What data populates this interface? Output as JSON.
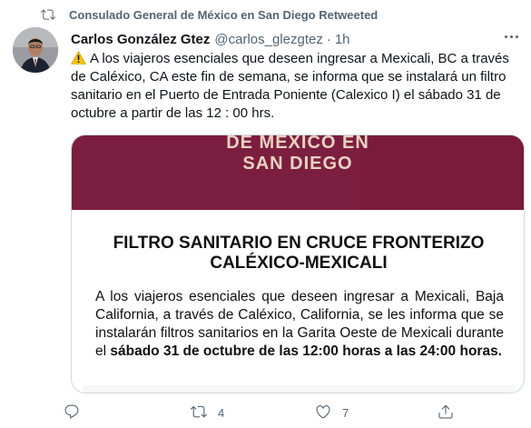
{
  "retweet": {
    "icon": "retweet-icon",
    "text": "Consulado General de México en San Diego Retweeted"
  },
  "tweet": {
    "avatar": "avatar",
    "display_name": "Carlos González Gtez",
    "handle": "@carlos_glezgtez",
    "separator": "·",
    "time": "1h",
    "more_icon": "more-icon",
    "warning_icon": "warning-icon",
    "text": "A los viajeros esenciales que deseen ingresar a Mexicali, BC a través de Caléxico, CA este fin de semana, se informa que se instalará un filtro sanitario en el Puerto de Entrada Poniente (Calexico I) el sábado 31 de octubre a partir de las 12 : 00 hrs."
  },
  "media": {
    "banner_line_1": "DE MÉXICO EN",
    "banner_line_2": "SAN DIEGO",
    "banner_color": "#7c1e3f",
    "title_line_1": "FILTRO SANITARIO EN CRUCE FRONTERIZO",
    "title_line_2": "CALÉXICO-MEXICALI",
    "body_plain": "A los viajeros esenciales que deseen ingresar a Mexicali, Baja California, a través de Caléxico, California, se les informa que se instalarán filtros sanitarios en la Garita Oeste de Mexicali durante el ",
    "body_bold": "sábado 31 de octubre de las 12:00 horas a las 24:00 horas."
  },
  "actions": {
    "reply_icon": "reply-icon",
    "retweet_icon": "retweet-icon",
    "retweet_count": "4",
    "like_icon": "heart-icon",
    "like_count": "7",
    "share_icon": "share-icon"
  }
}
